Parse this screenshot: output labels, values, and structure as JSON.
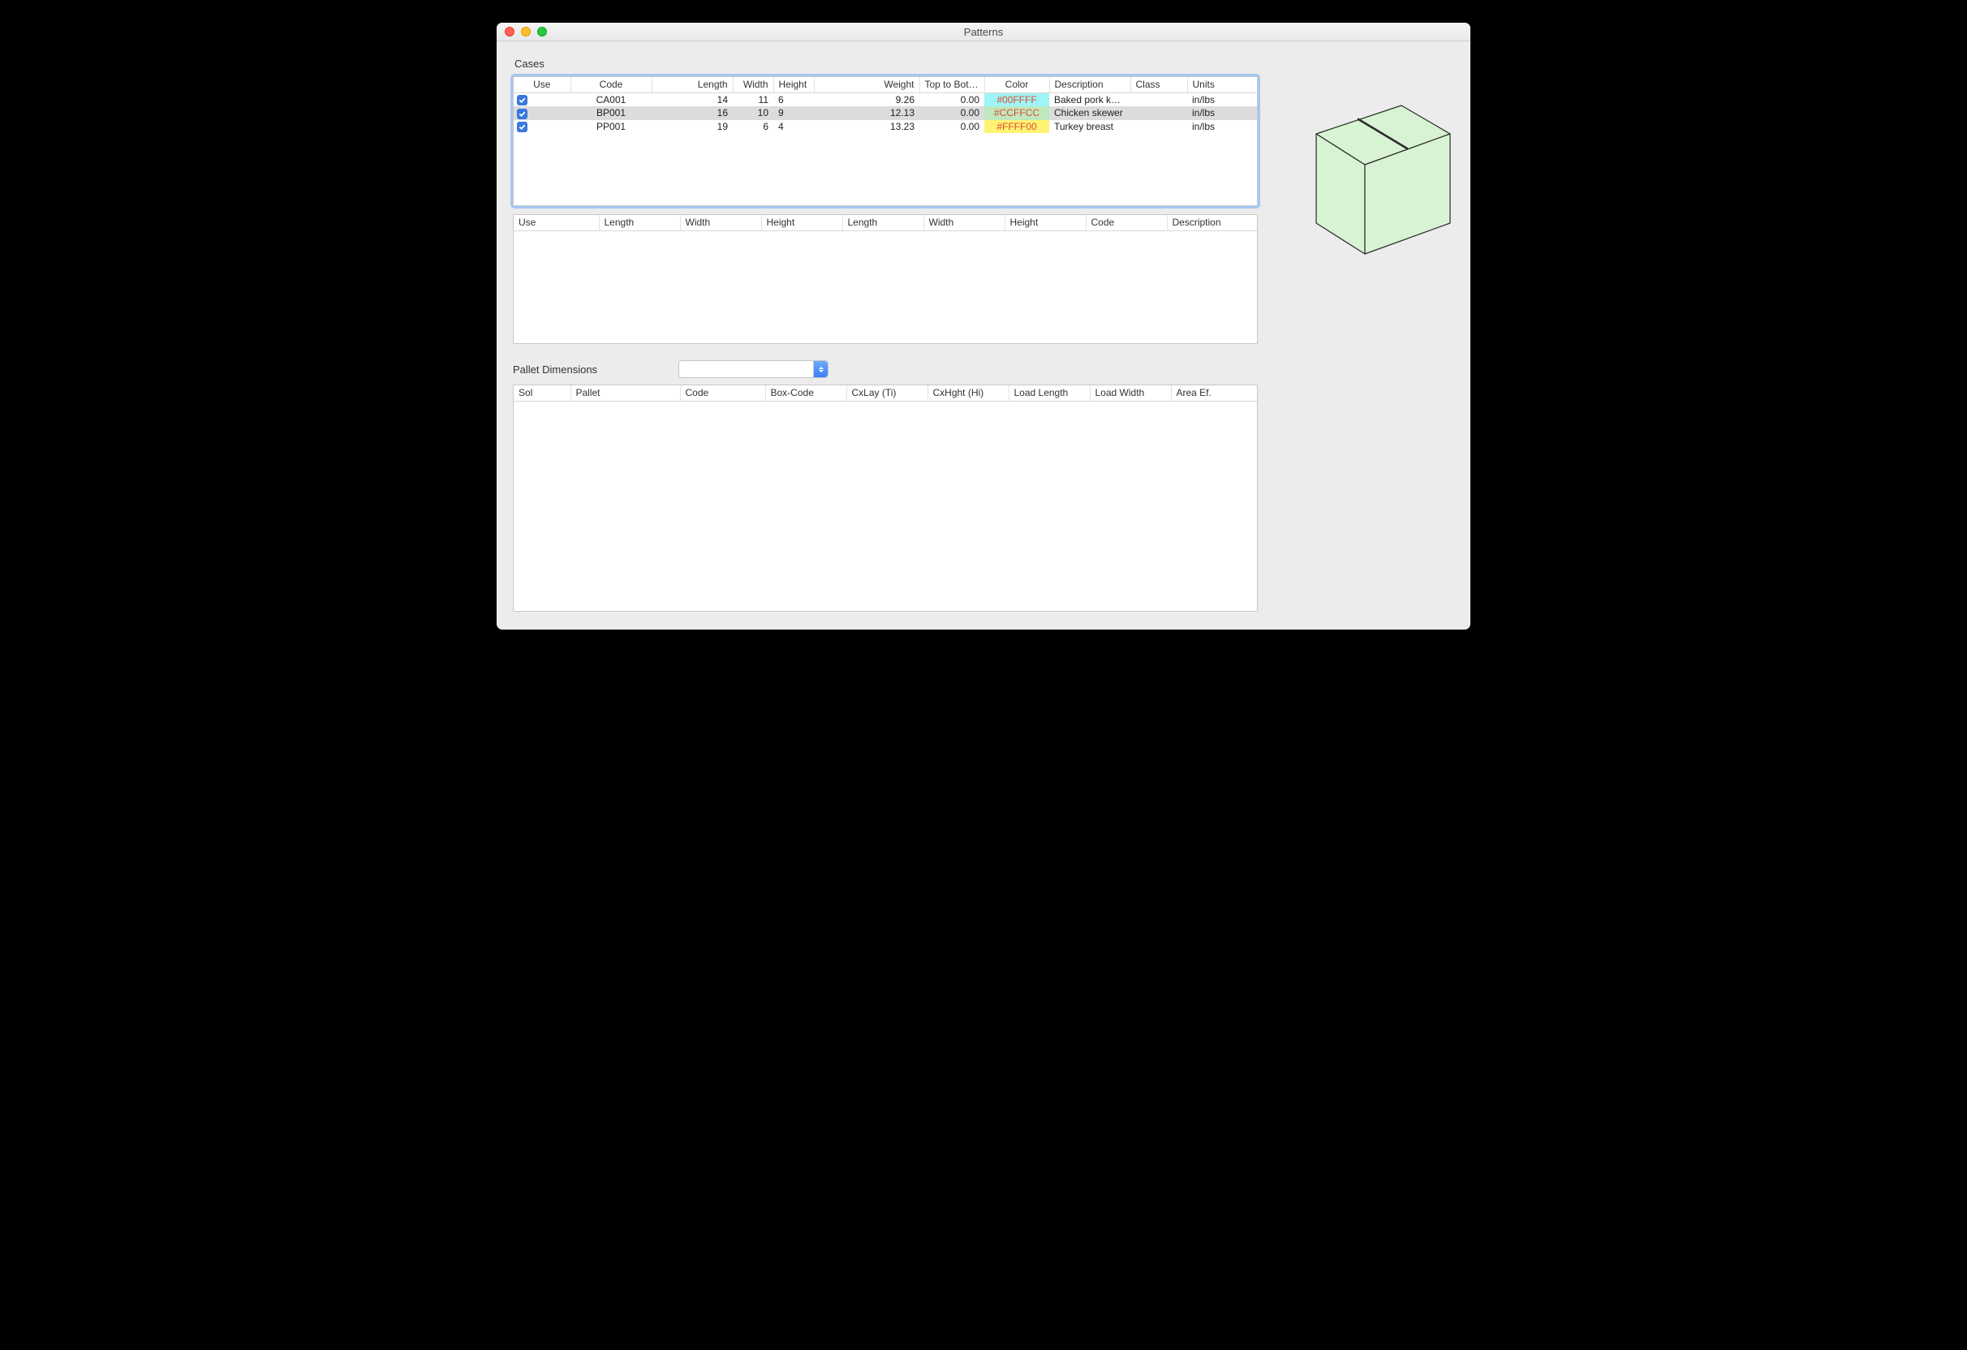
{
  "window": {
    "title": "Patterns"
  },
  "sections": {
    "cases": "Cases",
    "pallet": "Pallet Dimensions"
  },
  "casesTable": {
    "headers": {
      "use": "Use",
      "code": "Code",
      "length": "Length",
      "width": "Width",
      "height": "Height",
      "weight": "Weight",
      "topbott": "Top to Bott...",
      "color": "Color",
      "description": "Description",
      "class": "Class",
      "units": "Units"
    },
    "rows": [
      {
        "use": true,
        "code": "CA001",
        "length": "14",
        "width": "11",
        "height": "6",
        "weight": "9.26",
        "topbott": "0.00",
        "color": "#00FFFF",
        "colorBg": "#9ef4f6",
        "description": "Baked pork knuc...",
        "class": "",
        "units": "in/lbs"
      },
      {
        "use": true,
        "code": "BP001",
        "length": "16",
        "width": "10",
        "height": "9",
        "weight": "12.13",
        "topbott": "0.00",
        "color": "#CCFFCC",
        "colorBg": "#bfe8bf",
        "description": "Chicken skewer",
        "class": "",
        "units": "in/lbs",
        "selected": true
      },
      {
        "use": true,
        "code": "PP001",
        "length": "19",
        "width": "6",
        "height": "4",
        "weight": "13.23",
        "topbott": "0.00",
        "color": "#FFFF00",
        "colorBg": "#fff373",
        "description": "Turkey breast",
        "class": "",
        "units": "in/lbs"
      }
    ]
  },
  "secondaryTable": {
    "headers": {
      "use": "Use",
      "length": "Length",
      "width": "Width",
      "height": "Height",
      "length2": "Length",
      "width2": "Width",
      "height2": "Height",
      "code": "Code",
      "description": "Description"
    }
  },
  "palletSelect": {
    "value": ""
  },
  "palletTable": {
    "headers": {
      "sol": "Sol",
      "pallet": "Pallet",
      "code": "Code",
      "boxcode": "Box-Code",
      "cxlay": "CxLay (Ti)",
      "cxhght": "CxHght (Hi)",
      "loadlen": "Load Length",
      "loadwid": "Load Width",
      "areaef": "Area Ef."
    }
  },
  "preview": {
    "fill": "#d8f3d3",
    "stroke": "#2a2a2a"
  }
}
